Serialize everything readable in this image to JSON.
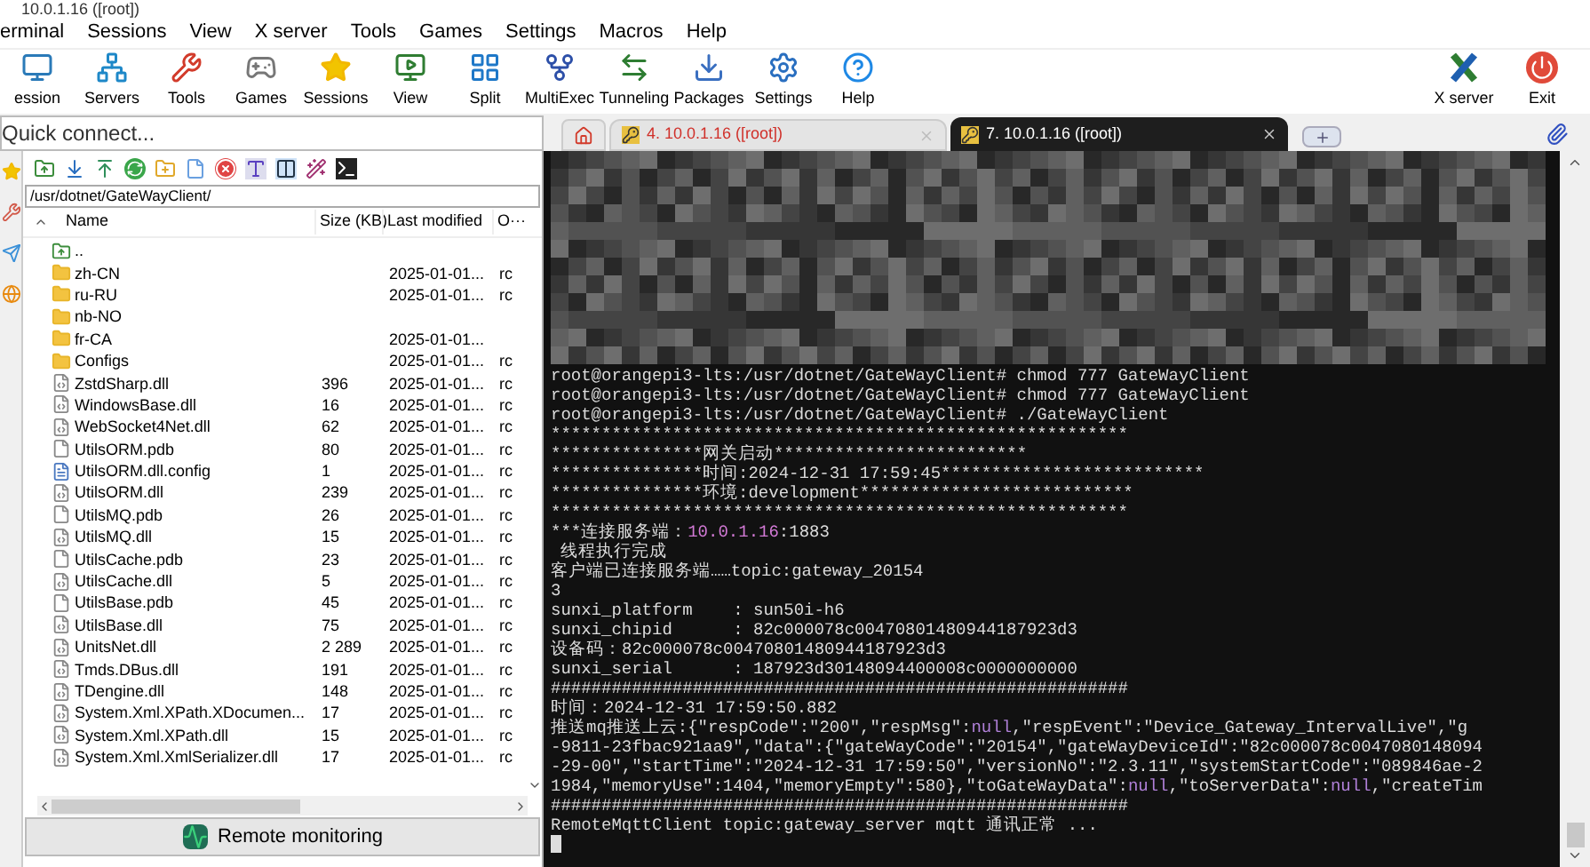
{
  "window": {
    "title": "10.0.1.16 ([root])"
  },
  "menu": [
    "erminal",
    "Sessions",
    "View",
    "X server",
    "Tools",
    "Games",
    "Settings",
    "Macros",
    "Help"
  ],
  "toolbar": {
    "left": [
      "ession",
      "Servers",
      "Tools",
      "Games",
      "Sessions",
      "View",
      "Split",
      "MultiExec",
      "Tunneling",
      "Packages",
      "Settings",
      "Help"
    ],
    "right": [
      "X server",
      "Exit"
    ]
  },
  "quick_connect": {
    "placeholder": "Quick connect..."
  },
  "tabs": [
    {
      "label": "4. 10.0.1.16 ([root])",
      "selected": false
    },
    {
      "label": "7. 10.0.1.16 ([root])",
      "selected": true
    }
  ],
  "file_browser": {
    "path": "/usr/dotnet/GateWayClient/",
    "columns": [
      "Name",
      "Size (KB)",
      "Last modified",
      "O···"
    ],
    "rows": [
      {
        "kind": "parent",
        "name": "..",
        "size": "",
        "modified": "",
        "owner": ""
      },
      {
        "kind": "folder",
        "name": "zh-CN",
        "size": "",
        "modified": "2025-01-01...",
        "owner": "rc"
      },
      {
        "kind": "folder",
        "name": "ru-RU",
        "size": "",
        "modified": "2025-01-01...",
        "owner": "rc"
      },
      {
        "kind": "folder",
        "name": "nb-NO",
        "size": "",
        "modified": "",
        "owner": ""
      },
      {
        "kind": "folder",
        "name": "fr-CA",
        "size": "",
        "modified": "2025-01-01...",
        "owner": ""
      },
      {
        "kind": "folder",
        "name": "Configs",
        "size": "",
        "modified": "2025-01-01...",
        "owner": "rc"
      },
      {
        "kind": "dll",
        "name": "ZstdSharp.dll",
        "size": "396",
        "modified": "2025-01-01...",
        "owner": "rc"
      },
      {
        "kind": "dll",
        "name": "WindowsBase.dll",
        "size": "16",
        "modified": "2025-01-01...",
        "owner": "rc"
      },
      {
        "kind": "dll",
        "name": "WebSocket4Net.dll",
        "size": "62",
        "modified": "2025-01-01...",
        "owner": "rc"
      },
      {
        "kind": "file",
        "name": "UtilsORM.pdb",
        "size": "80",
        "modified": "2025-01-01...",
        "owner": "rc"
      },
      {
        "kind": "config",
        "name": "UtilsORM.dll.config",
        "size": "1",
        "modified": "2025-01-01...",
        "owner": "rc"
      },
      {
        "kind": "dll",
        "name": "UtilsORM.dll",
        "size": "239",
        "modified": "2025-01-01...",
        "owner": "rc"
      },
      {
        "kind": "file",
        "name": "UtilsMQ.pdb",
        "size": "26",
        "modified": "2025-01-01...",
        "owner": "rc"
      },
      {
        "kind": "dll",
        "name": "UtilsMQ.dll",
        "size": "15",
        "modified": "2025-01-01...",
        "owner": "rc"
      },
      {
        "kind": "file",
        "name": "UtilsCache.pdb",
        "size": "23",
        "modified": "2025-01-01...",
        "owner": "rc"
      },
      {
        "kind": "dll",
        "name": "UtilsCache.dll",
        "size": "5",
        "modified": "2025-01-01...",
        "owner": "rc"
      },
      {
        "kind": "file",
        "name": "UtilsBase.pdb",
        "size": "45",
        "modified": "2025-01-01...",
        "owner": "rc"
      },
      {
        "kind": "dll",
        "name": "UtilsBase.dll",
        "size": "75",
        "modified": "2025-01-01...",
        "owner": "rc"
      },
      {
        "kind": "dll",
        "name": "UnitsNet.dll",
        "size": "2 289",
        "modified": "2025-01-01...",
        "owner": "rc"
      },
      {
        "kind": "dll",
        "name": "Tmds.DBus.dll",
        "size": "191",
        "modified": "2025-01-01...",
        "owner": "rc"
      },
      {
        "kind": "dll",
        "name": "TDengine.dll",
        "size": "148",
        "modified": "2025-01-01...",
        "owner": "rc"
      },
      {
        "kind": "dll",
        "name": "System.Xml.XPath.XDocumen...",
        "size": "17",
        "modified": "2025-01-01...",
        "owner": "rc"
      },
      {
        "kind": "dll",
        "name": "System.Xml.XPath.dll",
        "size": "15",
        "modified": "2025-01-01...",
        "owner": "rc"
      },
      {
        "kind": "dll",
        "name": "System.Xml.XmlSerializer.dll",
        "size": "17",
        "modified": "2025-01-01...",
        "owner": "rc"
      }
    ],
    "bottom_button": "Remote monitoring"
  },
  "terminal": {
    "lines": [
      [
        {
          "kind": "plain",
          "text": "root@orangepi3-lts:/usr/dotnet/GateWayClient# chmod 777 GateWayClient"
        }
      ],
      [
        {
          "kind": "plain",
          "text": "root@orangepi3-lts:/usr/dotnet/GateWayClient# chmod 777 GateWayClient"
        }
      ],
      [
        {
          "kind": "plain",
          "text": "root@orangepi3-lts:/usr/dotnet/GateWayClient# ./GateWayClient"
        }
      ],
      [
        {
          "kind": "plain",
          "text": "*********************************************************"
        }
      ],
      [
        {
          "kind": "plain",
          "text": "***************网关启动*************************"
        }
      ],
      [
        {
          "kind": "plain",
          "text": "***************时间:2024-12-31 17:59:45**************************"
        }
      ],
      [
        {
          "kind": "plain",
          "text": "***************环境:development***************************"
        }
      ],
      [
        {
          "kind": "plain",
          "text": "*********************************************************"
        }
      ],
      [
        {
          "kind": "plain",
          "text": "***连接服务端："
        },
        {
          "kind": "host",
          "text": "10.0.1.16"
        },
        {
          "kind": "plain",
          "text": ":1883"
        }
      ],
      [
        {
          "kind": "plain",
          "text": " 线程执行完成"
        }
      ],
      [
        {
          "kind": "plain",
          "text": "客户端已连接服务端……topic:gateway_20154"
        }
      ],
      [
        {
          "kind": "plain",
          "text": "3"
        }
      ],
      [
        {
          "kind": "plain",
          "text": "sunxi_platform    : sun50i-h6"
        }
      ],
      [
        {
          "kind": "plain",
          "text": "sunxi_chipid      : 82c000078c00470801480944187923d3"
        }
      ],
      [
        {
          "kind": "plain",
          "text": "设备码：82c000078c00470801480944187923d3"
        }
      ],
      [
        {
          "kind": "plain",
          "text": "sunxi_serial      : 187923d30148094400008c0000000000"
        }
      ],
      [
        {
          "kind": "plain",
          "text": "#########################################################"
        }
      ],
      [
        {
          "kind": "plain",
          "text": "时间：2024-12-31 17:59:50.882"
        }
      ],
      [
        {
          "kind": "plain",
          "text": "推送mq推送上云:{\"respCode\":\"200\",\"respMsg\":"
        },
        {
          "kind": "null",
          "text": "null"
        },
        {
          "kind": "plain",
          "text": ",\"respEvent\":\"Device_Gateway_IntervalLive\",\"g"
        }
      ],
      [
        {
          "kind": "plain",
          "text": "-9811-23fbac921aa9\",\"data\":{\"gateWayCode\":\"20154\",\"gateWayDeviceId\":\"82c000078c0047080148094"
        }
      ],
      [
        {
          "kind": "plain",
          "text": "-29-00\",\"startTime\":\"2024-12-31 17:59:50\",\"versionNo\":\"2.3.11\",\"systemStartCode\":\"089846ae-2"
        }
      ],
      [
        {
          "kind": "plain",
          "text": "1984,\"memoryUse\":1404,\"memoryEmpty\":580},\"toGateWayData\":"
        },
        {
          "kind": "null",
          "text": "null"
        },
        {
          "kind": "plain",
          "text": ",\"toServerData\":"
        },
        {
          "kind": "null",
          "text": "null"
        },
        {
          "kind": "plain",
          "text": ",\"createTim"
        }
      ],
      [
        {
          "kind": "plain",
          "text": "#########################################################"
        }
      ],
      [
        {
          "kind": "plain",
          "text": "RemoteMqttClient topic:gateway_server mqtt 通讯正常 ..."
        }
      ]
    ]
  }
}
